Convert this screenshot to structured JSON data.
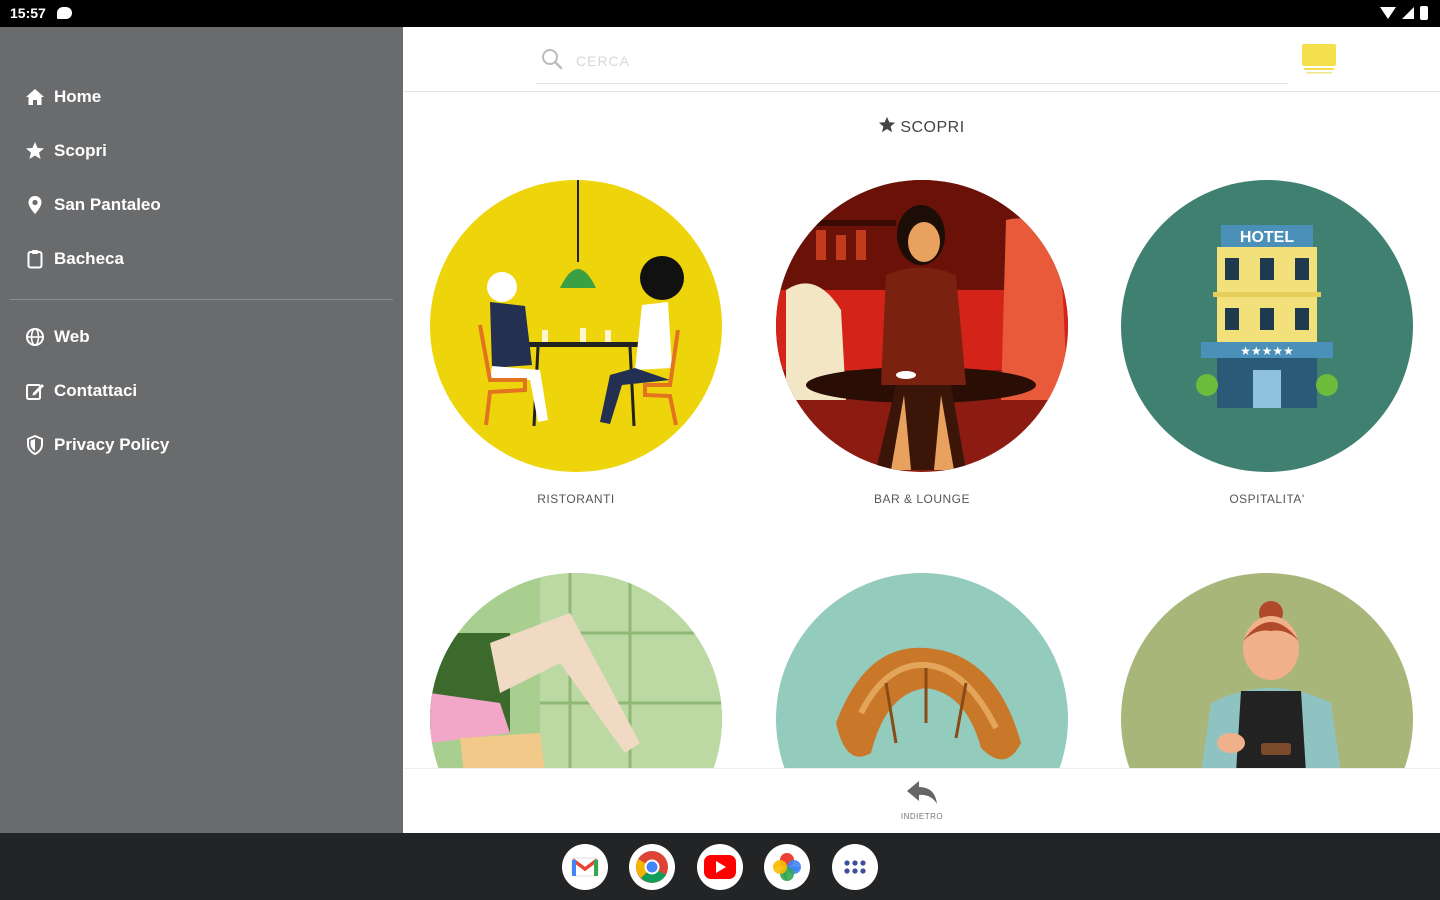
{
  "status": {
    "time": "15:57"
  },
  "drawer": {
    "items": [
      {
        "label": "Home",
        "icon": "home-icon"
      },
      {
        "label": "Scopri",
        "icon": "star-icon"
      },
      {
        "label": "San Pantaleo",
        "icon": "location-pin-icon"
      },
      {
        "label": "Bacheca",
        "icon": "clipboard-icon"
      },
      {
        "label": "Web",
        "icon": "globe-icon"
      },
      {
        "label": "Contattaci",
        "icon": "edit-icon"
      },
      {
        "label": "Privacy Policy",
        "icon": "shield-icon"
      }
    ]
  },
  "search": {
    "placeholder": "CERCA"
  },
  "section": {
    "title": "SCOPRI"
  },
  "categories": [
    {
      "label": "RISTORANTI"
    },
    {
      "label": "BAR & LOUNGE"
    },
    {
      "label": "OSPITALITA'"
    },
    {
      "label": ""
    },
    {
      "label": ""
    },
    {
      "label": ""
    }
  ],
  "hotel_sign": "HOTEL",
  "back": {
    "label": "INDIETRO"
  },
  "colors": {
    "drawer": "#6a6b6d",
    "accent_yellow": "#f4e04d",
    "restaurant_bg": "#eed40a",
    "bar_bg": "#8c1c12",
    "hotel_bg": "#3f8070",
    "shopping_bg": "#a8cf8f",
    "bakery_bg": "#93cbbd",
    "service_bg": "#a8b67a"
  }
}
